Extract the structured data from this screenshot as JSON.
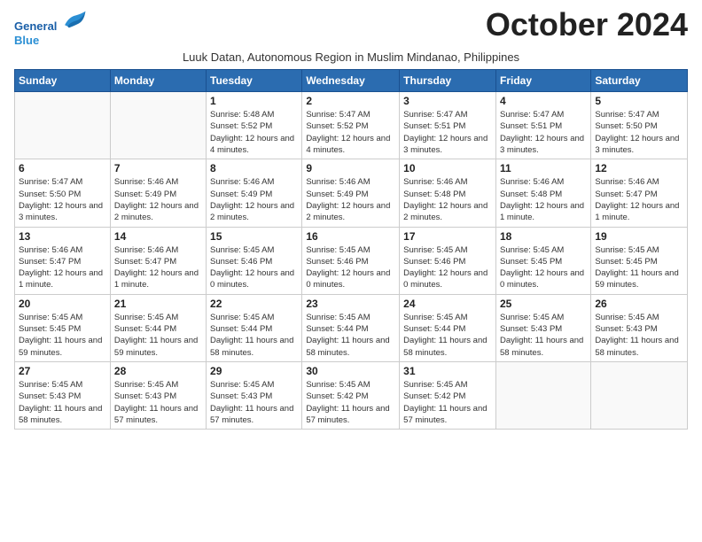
{
  "logo": {
    "line1": "General",
    "line2": "Blue"
  },
  "title": "October 2024",
  "subtitle": "Luuk Datan, Autonomous Region in Muslim Mindanao, Philippines",
  "days_of_week": [
    "Sunday",
    "Monday",
    "Tuesday",
    "Wednesday",
    "Thursday",
    "Friday",
    "Saturday"
  ],
  "weeks": [
    [
      {
        "day": "",
        "info": ""
      },
      {
        "day": "",
        "info": ""
      },
      {
        "day": "1",
        "info": "Sunrise: 5:48 AM\nSunset: 5:52 PM\nDaylight: 12 hours and 4 minutes."
      },
      {
        "day": "2",
        "info": "Sunrise: 5:47 AM\nSunset: 5:52 PM\nDaylight: 12 hours and 4 minutes."
      },
      {
        "day": "3",
        "info": "Sunrise: 5:47 AM\nSunset: 5:51 PM\nDaylight: 12 hours and 3 minutes."
      },
      {
        "day": "4",
        "info": "Sunrise: 5:47 AM\nSunset: 5:51 PM\nDaylight: 12 hours and 3 minutes."
      },
      {
        "day": "5",
        "info": "Sunrise: 5:47 AM\nSunset: 5:50 PM\nDaylight: 12 hours and 3 minutes."
      }
    ],
    [
      {
        "day": "6",
        "info": "Sunrise: 5:47 AM\nSunset: 5:50 PM\nDaylight: 12 hours and 3 minutes."
      },
      {
        "day": "7",
        "info": "Sunrise: 5:46 AM\nSunset: 5:49 PM\nDaylight: 12 hours and 2 minutes."
      },
      {
        "day": "8",
        "info": "Sunrise: 5:46 AM\nSunset: 5:49 PM\nDaylight: 12 hours and 2 minutes."
      },
      {
        "day": "9",
        "info": "Sunrise: 5:46 AM\nSunset: 5:49 PM\nDaylight: 12 hours and 2 minutes."
      },
      {
        "day": "10",
        "info": "Sunrise: 5:46 AM\nSunset: 5:48 PM\nDaylight: 12 hours and 2 minutes."
      },
      {
        "day": "11",
        "info": "Sunrise: 5:46 AM\nSunset: 5:48 PM\nDaylight: 12 hours and 1 minute."
      },
      {
        "day": "12",
        "info": "Sunrise: 5:46 AM\nSunset: 5:47 PM\nDaylight: 12 hours and 1 minute."
      }
    ],
    [
      {
        "day": "13",
        "info": "Sunrise: 5:46 AM\nSunset: 5:47 PM\nDaylight: 12 hours and 1 minute."
      },
      {
        "day": "14",
        "info": "Sunrise: 5:46 AM\nSunset: 5:47 PM\nDaylight: 12 hours and 1 minute."
      },
      {
        "day": "15",
        "info": "Sunrise: 5:45 AM\nSunset: 5:46 PM\nDaylight: 12 hours and 0 minutes."
      },
      {
        "day": "16",
        "info": "Sunrise: 5:45 AM\nSunset: 5:46 PM\nDaylight: 12 hours and 0 minutes."
      },
      {
        "day": "17",
        "info": "Sunrise: 5:45 AM\nSunset: 5:46 PM\nDaylight: 12 hours and 0 minutes."
      },
      {
        "day": "18",
        "info": "Sunrise: 5:45 AM\nSunset: 5:45 PM\nDaylight: 12 hours and 0 minutes."
      },
      {
        "day": "19",
        "info": "Sunrise: 5:45 AM\nSunset: 5:45 PM\nDaylight: 11 hours and 59 minutes."
      }
    ],
    [
      {
        "day": "20",
        "info": "Sunrise: 5:45 AM\nSunset: 5:45 PM\nDaylight: 11 hours and 59 minutes."
      },
      {
        "day": "21",
        "info": "Sunrise: 5:45 AM\nSunset: 5:44 PM\nDaylight: 11 hours and 59 minutes."
      },
      {
        "day": "22",
        "info": "Sunrise: 5:45 AM\nSunset: 5:44 PM\nDaylight: 11 hours and 58 minutes."
      },
      {
        "day": "23",
        "info": "Sunrise: 5:45 AM\nSunset: 5:44 PM\nDaylight: 11 hours and 58 minutes."
      },
      {
        "day": "24",
        "info": "Sunrise: 5:45 AM\nSunset: 5:44 PM\nDaylight: 11 hours and 58 minutes."
      },
      {
        "day": "25",
        "info": "Sunrise: 5:45 AM\nSunset: 5:43 PM\nDaylight: 11 hours and 58 minutes."
      },
      {
        "day": "26",
        "info": "Sunrise: 5:45 AM\nSunset: 5:43 PM\nDaylight: 11 hours and 58 minutes."
      }
    ],
    [
      {
        "day": "27",
        "info": "Sunrise: 5:45 AM\nSunset: 5:43 PM\nDaylight: 11 hours and 58 minutes."
      },
      {
        "day": "28",
        "info": "Sunrise: 5:45 AM\nSunset: 5:43 PM\nDaylight: 11 hours and 57 minutes."
      },
      {
        "day": "29",
        "info": "Sunrise: 5:45 AM\nSunset: 5:43 PM\nDaylight: 11 hours and 57 minutes."
      },
      {
        "day": "30",
        "info": "Sunrise: 5:45 AM\nSunset: 5:42 PM\nDaylight: 11 hours and 57 minutes."
      },
      {
        "day": "31",
        "info": "Sunrise: 5:45 AM\nSunset: 5:42 PM\nDaylight: 11 hours and 57 minutes."
      },
      {
        "day": "",
        "info": ""
      },
      {
        "day": "",
        "info": ""
      }
    ]
  ]
}
